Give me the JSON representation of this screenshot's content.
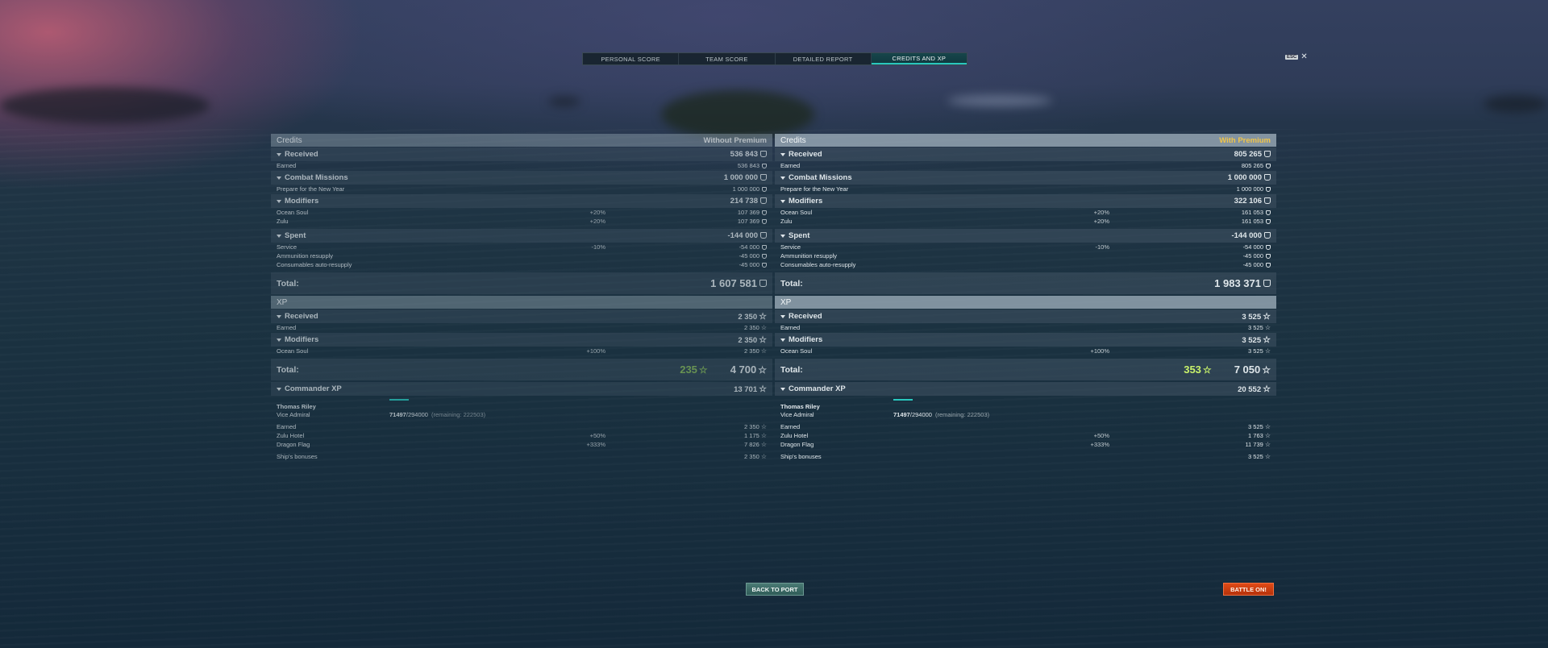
{
  "tabs": [
    "PERSONAL SCORE",
    "TEAM SCORE",
    "DETAILED REPORT",
    "CREDITS AND XP"
  ],
  "active_tab": 3,
  "esc_label": "ESC",
  "colors": {
    "accent": "#29c7bd",
    "premium": "#f0c54a",
    "battle": "#e04b16",
    "xp_gain": "#9fd34c"
  },
  "left": {
    "credits_title": "Credits",
    "premium_label": "Without Premium",
    "received": {
      "label": "Received",
      "value": "536 843",
      "earned_label": "Earned",
      "earned_value": "536 843"
    },
    "missions": {
      "label": "Combat Missions",
      "value": "1 000 000",
      "item_label": "Prepare for the New Year",
      "item_value": "1 000 000"
    },
    "modifiers": {
      "label": "Modifiers",
      "value": "214 738",
      "items": [
        {
          "name": "Ocean Soul",
          "pct": "+20%",
          "value": "107 369"
        },
        {
          "name": "Zulu",
          "pct": "+20%",
          "value": "107 369"
        }
      ]
    },
    "spent": {
      "label": "Spent",
      "value": "-144 000",
      "items": [
        {
          "name": "Service",
          "pct": "-10%",
          "value": "-54 000"
        },
        {
          "name": "Ammunition resupply",
          "pct": "",
          "value": "-45 000"
        },
        {
          "name": "Consumables auto-resupply",
          "pct": "",
          "value": "-45 000"
        }
      ]
    },
    "credits_total_label": "Total:",
    "credits_total": "1 607 581",
    "xp_title": "XP",
    "xp_received": {
      "label": "Received",
      "value": "2 350",
      "earned_label": "Earned",
      "earned_value": "2 350"
    },
    "xp_modifiers": {
      "label": "Modifiers",
      "value": "2 350",
      "item_name": "Ocean Soul",
      "item_pct": "+100%",
      "item_value": "2 350"
    },
    "xp_total_label": "Total:",
    "xp_gain": "235",
    "xp_total": "4 700",
    "commander": {
      "label": "Commander XP",
      "value": "13 701",
      "name": "Thomas Riley",
      "rank": "Vice Admiral",
      "progress_current": "71497",
      "progress_max": "/294000",
      "remaining": "(remaining: 222503)",
      "earned_label": "Earned",
      "earned_value": "2 350",
      "items": [
        {
          "name": "Zulu Hotel",
          "pct": "+50%",
          "value": "1 175"
        },
        {
          "name": "Dragon Flag",
          "pct": "+333%",
          "value": "7 826"
        }
      ],
      "bonus_label": "Ship's bonuses",
      "bonus_value": "2 350"
    }
  },
  "right": {
    "credits_title": "Credits",
    "premium_label": "With Premium",
    "received": {
      "label": "Received",
      "value": "805 265",
      "earned_label": "Earned",
      "earned_value": "805 265"
    },
    "missions": {
      "label": "Combat Missions",
      "value": "1 000 000",
      "item_label": "Prepare for the New Year",
      "item_value": "1 000 000"
    },
    "modifiers": {
      "label": "Modifiers",
      "value": "322 106",
      "items": [
        {
          "name": "Ocean Soul",
          "pct": "+20%",
          "value": "161 053"
        },
        {
          "name": "Zulu",
          "pct": "+20%",
          "value": "161 053"
        }
      ]
    },
    "spent": {
      "label": "Spent",
      "value": "-144 000",
      "items": [
        {
          "name": "Service",
          "pct": "-10%",
          "value": "-54 000"
        },
        {
          "name": "Ammunition resupply",
          "pct": "",
          "value": "-45 000"
        },
        {
          "name": "Consumables auto-resupply",
          "pct": "",
          "value": "-45 000"
        }
      ]
    },
    "credits_total_label": "Total:",
    "credits_total": "1 983 371",
    "xp_title": "XP",
    "xp_received": {
      "label": "Received",
      "value": "3 525",
      "earned_label": "Earned",
      "earned_value": "3 525"
    },
    "xp_modifiers": {
      "label": "Modifiers",
      "value": "3 525",
      "item_name": "Ocean Soul",
      "item_pct": "+100%",
      "item_value": "3 525"
    },
    "xp_total_label": "Total:",
    "xp_gain": "353",
    "xp_total": "7 050",
    "commander": {
      "label": "Commander XP",
      "value": "20 552",
      "name": "Thomas Riley",
      "rank": "Vice Admiral",
      "progress_current": "71497",
      "progress_max": "/294000",
      "remaining": "(remaining: 222503)",
      "earned_label": "Earned",
      "earned_value": "3 525",
      "items": [
        {
          "name": "Zulu Hotel",
          "pct": "+50%",
          "value": "1 763"
        },
        {
          "name": "Dragon Flag",
          "pct": "+333%",
          "value": "11 739"
        }
      ],
      "bonus_label": "Ship's bonuses",
      "bonus_value": "3 525"
    }
  },
  "buttons": {
    "back": "BACK TO PORT",
    "battle": "BATTLE ON!"
  }
}
